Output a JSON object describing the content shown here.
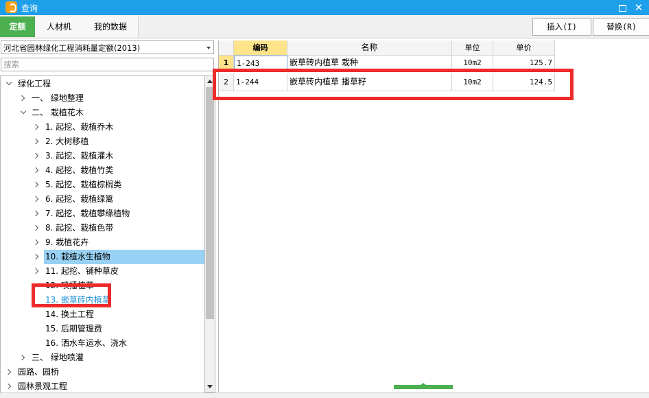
{
  "window": {
    "title": "查询"
  },
  "tabs": [
    "定额",
    "人材机",
    "我的数据"
  ],
  "toolbar": {
    "insert_label": "插入(I)",
    "replace_label": "替换(R)"
  },
  "quota_book": {
    "selected": "河北省园林绿化工程消耗量定额(2013)"
  },
  "search": {
    "placeholder": "搜索"
  },
  "tree": [
    {
      "label": "绿化工程",
      "expanded": true
    },
    {
      "label": "一、 绿地整理",
      "expanded": false
    },
    {
      "label": "二、 栽植花木",
      "expanded": true
    },
    {
      "label": "1. 起挖、栽植乔木",
      "expanded": false
    },
    {
      "label": "2. 大树移植",
      "expanded": false
    },
    {
      "label": "3. 起挖、栽植灌木",
      "expanded": false
    },
    {
      "label": "4. 起挖、栽植竹类",
      "expanded": false
    },
    {
      "label": "5. 起挖、栽植棕榈类",
      "expanded": false
    },
    {
      "label": "6. 起挖、栽植绿篱",
      "expanded": false
    },
    {
      "label": "7. 起挖、栽植攀缘植物",
      "expanded": false
    },
    {
      "label": "8. 起挖、栽植色带",
      "expanded": false
    },
    {
      "label": "9. 栽植花卉",
      "expanded": false
    },
    {
      "label": "10. 栽植水生植物",
      "expanded": false,
      "selected": true
    },
    {
      "label": "11. 起挖、铺种草皮",
      "expanded": false
    },
    {
      "label": "12. 喷播植草"
    },
    {
      "label": "13. 嵌草砖内植草",
      "highlighted": true
    },
    {
      "label": "14. 换土工程"
    },
    {
      "label": "15. 后期管理费"
    },
    {
      "label": "16. 洒水车运水、浇水"
    },
    {
      "label": "三、 绿地喷灌",
      "expanded": false
    },
    {
      "label": "园路、园桥",
      "expanded": false
    },
    {
      "label": "园林景观工程",
      "expanded": false
    }
  ],
  "table": {
    "columns": [
      "编码",
      "名称",
      "单位",
      "单价"
    ],
    "rows": [
      {
        "index": "1",
        "code": "1-243",
        "name": "嵌草砖内植草 栽种",
        "unit": "10m2",
        "price": "125.7"
      },
      {
        "index": "2",
        "code": "1-244",
        "name": "嵌草砖内植草 播草籽",
        "unit": "10m2",
        "price": "124.5"
      }
    ]
  },
  "colors": {
    "titlebar": "#1e9fea",
    "active_tab": "#4caf50",
    "selection": "#99d1f5",
    "annotation": "#ee2b2b",
    "highlight_text": "#1e8fd8"
  }
}
